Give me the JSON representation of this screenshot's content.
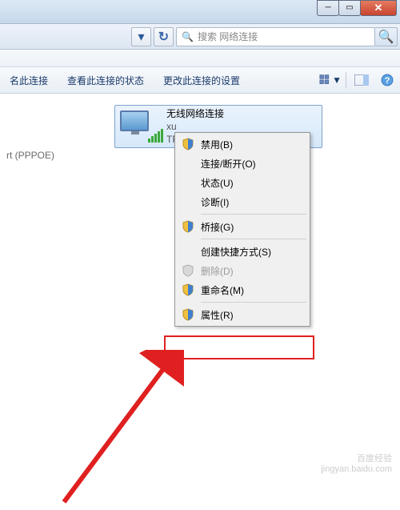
{
  "search": {
    "placeholder": "搜索 网络连接"
  },
  "toolbar": {
    "rename": "名此连接",
    "status": "查看此连接的状态",
    "change": "更改此连接的设置"
  },
  "left_item": "rt (PPPOE)",
  "connection": {
    "title": "无线网络连接",
    "line2": "xu",
    "line3": "TP"
  },
  "menu": {
    "disable": "禁用(B)",
    "connect": "连接/断开(O)",
    "status": "状态(U)",
    "diagnose": "诊断(I)",
    "bridge": "桥接(G)",
    "shortcut": "创建快捷方式(S)",
    "delete": "删除(D)",
    "rename": "重命名(M)",
    "properties": "属性(R)"
  },
  "watermark": {
    "line1": "百度经验",
    "line2": "jingyan.baidu.com"
  }
}
